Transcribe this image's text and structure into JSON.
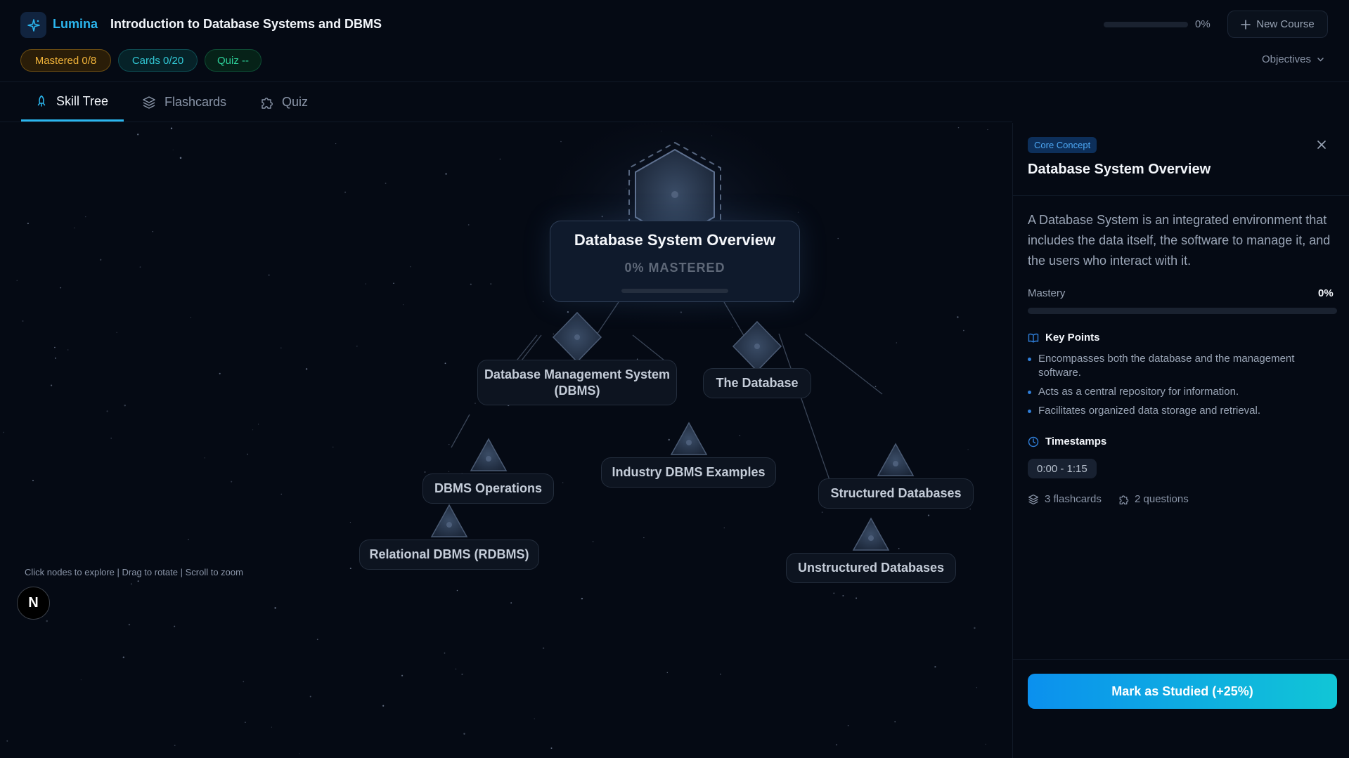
{
  "header": {
    "brand": "Lumina",
    "course_title": "Introduction to Database Systems and DBMS",
    "progress_percent_label": "0%",
    "progress_value": 0,
    "new_course_label": "New Course",
    "objectives_label": "Objectives"
  },
  "stats": {
    "mastered": "Mastered 0/8",
    "cards": "Cards 0/20",
    "quiz": "Quiz --"
  },
  "tabs": [
    {
      "label": "Skill Tree",
      "icon": "rocket-icon",
      "active": true
    },
    {
      "label": "Flashcards",
      "icon": "layers-icon",
      "active": false
    },
    {
      "label": "Quiz",
      "icon": "puzzle-icon",
      "active": false
    }
  ],
  "tree": {
    "root": {
      "title": "Database System Overview",
      "mastered_label": "0% MASTERED",
      "mastery": 0
    },
    "nodes": [
      {
        "label": "Database Management System (DBMS)",
        "shape": "diamond"
      },
      {
        "label": "The Database",
        "shape": "diamond"
      },
      {
        "label": "DBMS Operations",
        "shape": "triangle"
      },
      {
        "label": "Industry DBMS Examples",
        "shape": "triangle"
      },
      {
        "label": "Structured Databases",
        "shape": "triangle"
      },
      {
        "label": "Relational DBMS (RDBMS)",
        "shape": "triangle"
      },
      {
        "label": "Unstructured Databases",
        "shape": "triangle"
      }
    ],
    "hint": "Click nodes to explore | Drag to rotate | Scroll to zoom",
    "badge": "N"
  },
  "panel": {
    "badge": "Core Concept",
    "title": "Database System Overview",
    "description": "A Database System is an integrated environment that includes the data itself, the software to manage it, and the users who interact with it.",
    "mastery_label": "Mastery",
    "mastery_value": "0%",
    "key_points_heading": "Key Points",
    "key_points": [
      "Encompasses both the database and the management software.",
      "Acts as a central repository for information.",
      "Facilitates organized data storage and retrieval."
    ],
    "timestamps_heading": "Timestamps",
    "timestamp": "0:00 - 1:15",
    "flashcards_count": "3 flashcards",
    "questions_count": "2 questions",
    "study_button": "Mark as Studied (+25%)"
  },
  "colors": {
    "accent": "#2bb6ee",
    "mastered_pill": "#f2b43a",
    "cards_pill": "#32c9d6",
    "quiz_pill": "#2ed19a",
    "background": "#050a14"
  }
}
